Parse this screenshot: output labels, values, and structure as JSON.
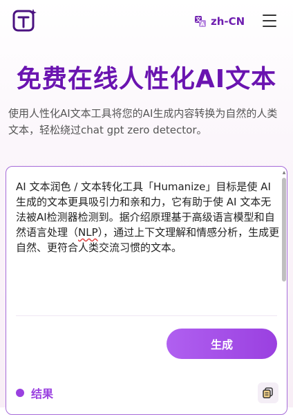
{
  "header": {
    "language_label": "zh-CN"
  },
  "hero": {
    "title": "免费在线人性化AI文本",
    "subtitle": "使用人性化AI文本工具将您的AI生成内容转换为自然的人类文本，轻松绕过chat gpt zero detector。"
  },
  "editor": {
    "text_before": "AI 文本润色 / 文本转化工具「Humanize」目标是使 AI 生成的文本更具吸引力和亲和力，它有助于使 AI 文本无法被AI检测器检测到。据介绍原理基于高级语言模型和自然语言处理（",
    "text_underlined": "NLP",
    "text_after": "），通过上下文理解和情感分析，生成更自然、更符合人类交流习惯的文本。",
    "generate_label": "生成",
    "result_label": "结果"
  },
  "colors": {
    "brand": "#6a14b0",
    "button": "#9a40e0"
  }
}
